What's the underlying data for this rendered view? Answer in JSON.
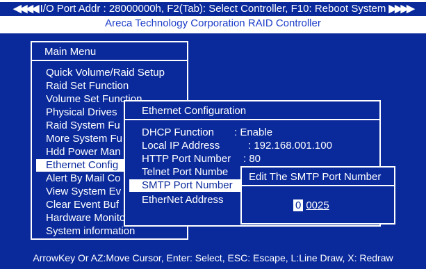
{
  "header": {
    "left_arrows": "◀◀◀◀",
    "right_arrows": "▶▶▶▶",
    "status_line": "I/O Port Addr : 28000000h, F2(Tab): Select Controller, F10: Reboot System",
    "subtitle": "Areca Technology Corporation RAID Controller"
  },
  "main_menu": {
    "title": "Main Menu",
    "items": [
      "Quick Volume/Raid Setup",
      "Raid Set Function",
      "Volume Set Function",
      "Physical Drives",
      "Raid System Fu",
      "More System Fu",
      "Hdd Power Man",
      "Ethernet Config",
      "Alert By Mail Co",
      "View System Ev",
      "Clear Event Buf",
      "Hardware Monito",
      "System information"
    ],
    "selected_index": 7
  },
  "ethernet": {
    "title": "Ethernet Configuration",
    "rows": [
      {
        "label": "DHCP Function",
        "value": ": Enable"
      },
      {
        "label": "Local IP Address",
        "value": ": 192.168.001.100"
      },
      {
        "label": "HTTP  Port  Number",
        "value": ":  80"
      },
      {
        "label": "Telnet  Port  Numbe",
        "value": ""
      },
      {
        "label": "SMTP Port Number",
        "value": ""
      },
      {
        "label": "EtherNet  Address",
        "value": ""
      }
    ],
    "selected_index": 4
  },
  "smtp_dialog": {
    "title": "Edit The SMTP Port Number",
    "cursor_digit": "0",
    "rest_value": "0025"
  },
  "footer": {
    "help_text": "ArrowKey Or AZ:Move Cursor, Enter: Select, ESC: Escape, L:Line Draw, X: Redraw"
  },
  "colors": {
    "background": "#0a2a9c",
    "foreground": "#ffffff",
    "subtitle": "#1a3cc8"
  }
}
